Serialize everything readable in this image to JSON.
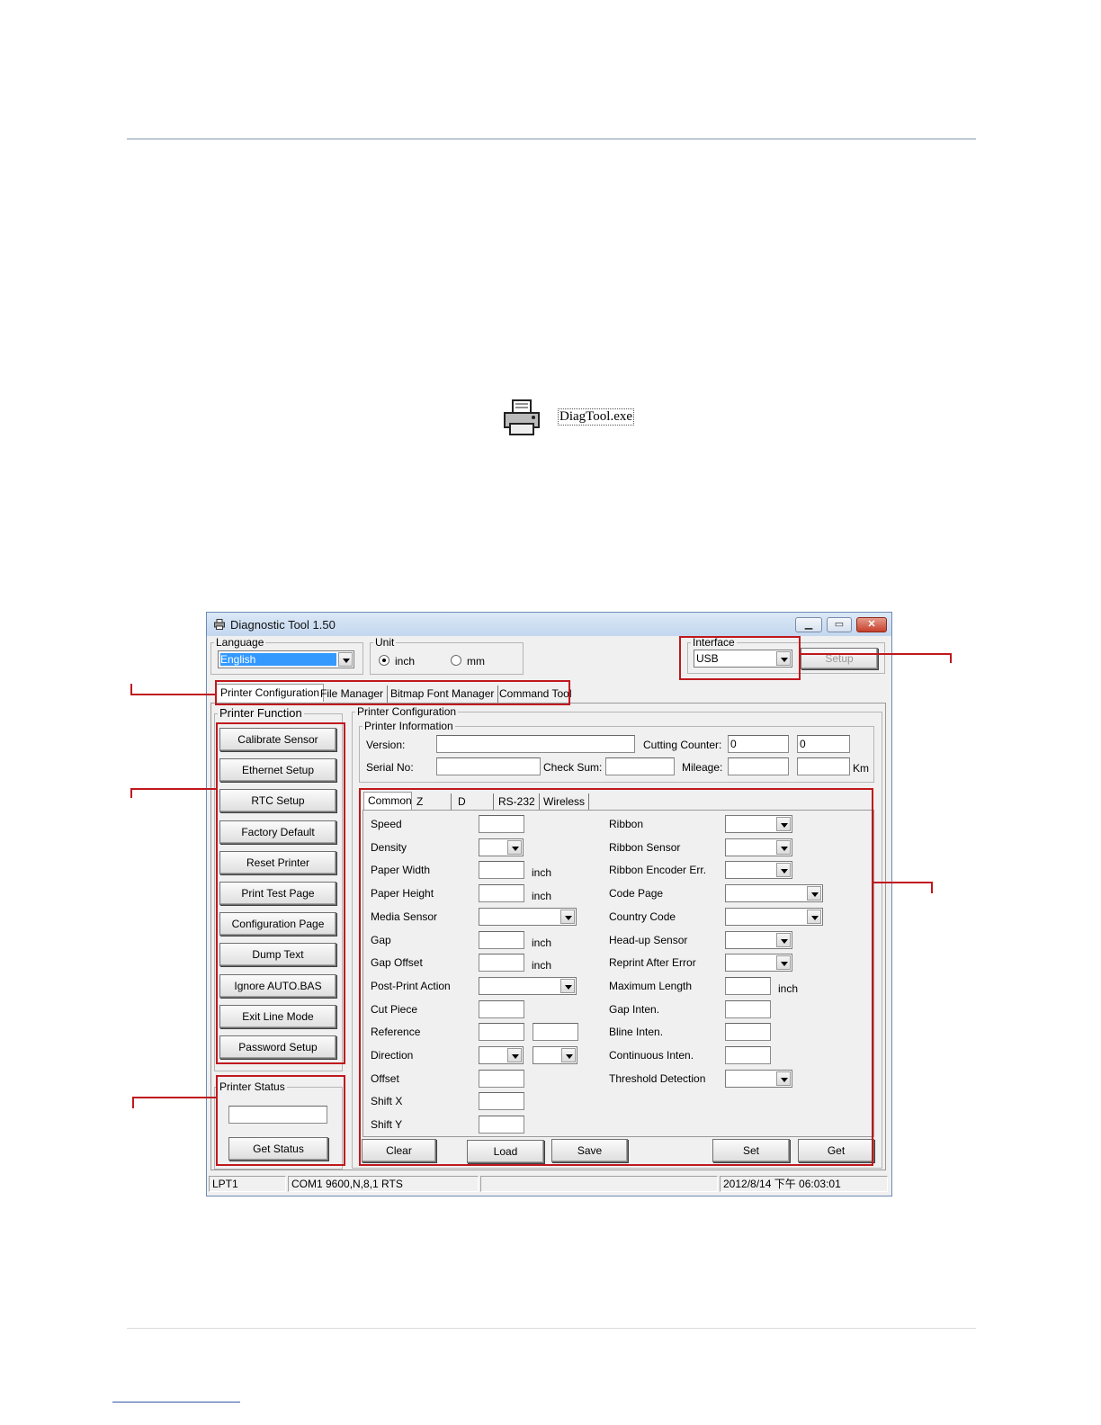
{
  "document": {
    "exe_label": "DiagTool.exe"
  },
  "window": {
    "title": "Diagnostic Tool 1.50",
    "language": {
      "legend": "Language",
      "value": "English"
    },
    "unit": {
      "legend": "Unit",
      "options": [
        "inch",
        "mm"
      ],
      "selected": "inch"
    },
    "interface": {
      "legend": "Interface",
      "value": "USB",
      "setup_label": "Setup"
    },
    "main_tabs": [
      "Printer Configuration",
      "File Manager",
      "Bitmap Font Manager",
      "Command Tool"
    ],
    "printer_function": {
      "legend": "Printer Function",
      "buttons": [
        "Calibrate Sensor",
        "Ethernet Setup",
        "RTC Setup",
        "Factory Default",
        "Reset Printer",
        "Print Test Page",
        "Configuration Page",
        "Dump Text",
        "Ignore AUTO.BAS",
        "Exit Line Mode",
        "Password Setup"
      ]
    },
    "printer_status": {
      "legend": "Printer Status",
      "value": "",
      "button": "Get Status"
    },
    "printer_configuration": {
      "legend": "Printer Configuration",
      "info_legend": "Printer Information",
      "version_label": "Version:",
      "cutting_counter_label": "Cutting Counter:",
      "cutting_counter_values": [
        "0",
        "0"
      ],
      "serial_label": "Serial No:",
      "checksum_label": "Check Sum:",
      "mileage_label": "Mileage:",
      "mileage_unit": "Km"
    },
    "sub_tabs": [
      "Common",
      "Z",
      "D",
      "RS-232",
      "Wireless"
    ],
    "common_left": [
      {
        "label": "Speed",
        "unit": ""
      },
      {
        "label": "Density",
        "unit": ""
      },
      {
        "label": "Paper Width",
        "unit": "inch"
      },
      {
        "label": "Paper Height",
        "unit": "inch"
      },
      {
        "label": "Media Sensor",
        "unit": ""
      },
      {
        "label": "Gap",
        "unit": "inch"
      },
      {
        "label": "Gap Offset",
        "unit": "inch"
      },
      {
        "label": "Post-Print Action",
        "unit": ""
      },
      {
        "label": "Cut Piece",
        "unit": ""
      },
      {
        "label": "Reference",
        "unit": ""
      },
      {
        "label": "Direction",
        "unit": ""
      },
      {
        "label": "Offset",
        "unit": ""
      },
      {
        "label": "Shift X",
        "unit": ""
      },
      {
        "label": "Shift Y",
        "unit": ""
      }
    ],
    "common_right": [
      {
        "label": "Ribbon",
        "unit": ""
      },
      {
        "label": "Ribbon Sensor",
        "unit": ""
      },
      {
        "label": "Ribbon Encoder Err.",
        "unit": ""
      },
      {
        "label": "Code Page",
        "unit": ""
      },
      {
        "label": "Country Code",
        "unit": ""
      },
      {
        "label": "Head-up Sensor",
        "unit": ""
      },
      {
        "label": "Reprint After Error",
        "unit": ""
      },
      {
        "label": "Maximum Length",
        "unit": "inch"
      },
      {
        "label": "Gap Inten.",
        "unit": ""
      },
      {
        "label": "Bline Inten.",
        "unit": ""
      },
      {
        "label": "Continuous Inten.",
        "unit": ""
      },
      {
        "label": "Threshold Detection",
        "unit": ""
      }
    ],
    "action_buttons": [
      "Clear",
      "Load",
      "Save",
      "Set",
      "Get"
    ],
    "status_bar": [
      "LPT1",
      "COM1 9600,N,8,1 RTS",
      "",
      "2012/8/14 下午 06:03:01"
    ]
  },
  "colors": {
    "annotation": "#c0181e",
    "selection": "#3399ff",
    "title_bar": "#c3d7ef"
  },
  "icons": [
    "printer-icon",
    "minimize-icon",
    "maximize-icon",
    "close-icon",
    "dropdown-arrow-icon"
  ]
}
